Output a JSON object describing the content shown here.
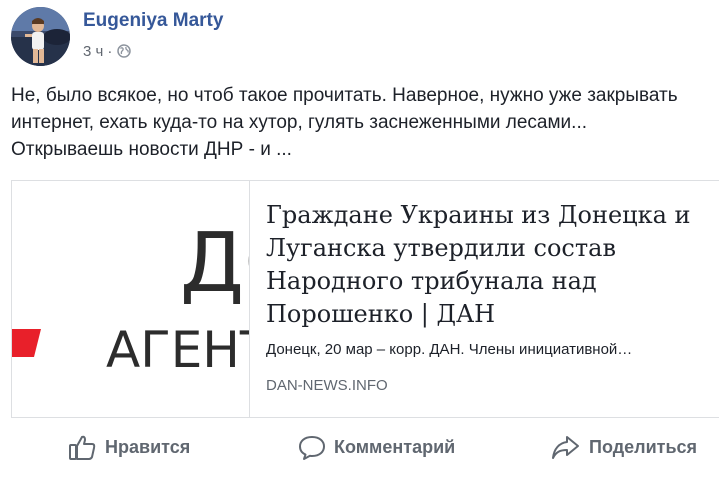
{
  "post": {
    "author": "Eugeniya Marty",
    "time": "3 ч",
    "separator": "·",
    "audience_icon": "globe-icon",
    "text_lines": [
      "Не, было всякое, но чтоб такое прочитать. Наверное, нужно уже закрывать",
      "интернет, ехать куда-то на хутор, гулять заснеженными лесами...",
      "Открываешь новости ДНР - и ..."
    ]
  },
  "link_card": {
    "image_text": {
      "big": "ДО",
      "small": "АГЕНТ"
    },
    "title_lines": [
      "Граждане Украины из Донецка и",
      "Луганска утвердили состав",
      "Народного трибунала над",
      "Порошенко | ДАН"
    ],
    "description": "Донецк, 20 мар – корр. ДАН. Члены инициативной…",
    "domain": "DAN-NEWS.INFO"
  },
  "actions": {
    "like": {
      "label": "Нравится",
      "icon": "thumbs-up-icon"
    },
    "comment": {
      "label": "Комментарий",
      "icon": "comment-icon"
    },
    "share": {
      "label": "Поделиться",
      "icon": "share-icon"
    }
  },
  "colors": {
    "author": "#365899",
    "text": "#1d2129",
    "muted": "#606770",
    "border": "#dddfe2",
    "accent_red": "#e8202a"
  }
}
